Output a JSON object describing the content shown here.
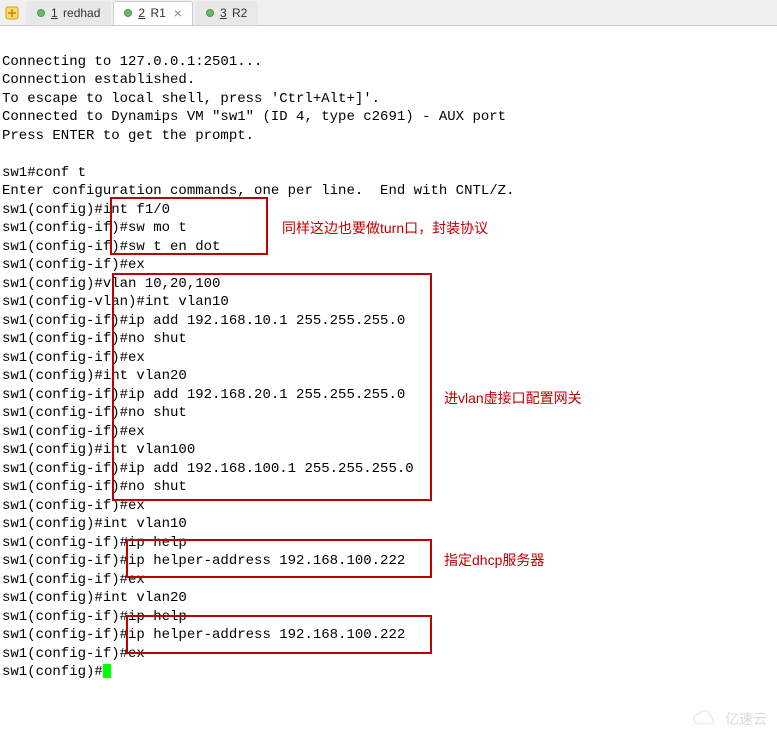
{
  "tabs": [
    {
      "num": "1",
      "label": "redhad",
      "active": false
    },
    {
      "num": "2",
      "label": "R1",
      "active": true
    },
    {
      "num": "3",
      "label": "R2",
      "active": false
    }
  ],
  "terminal_lines": [
    "",
    "Connecting to 127.0.0.1:2501...",
    "Connection established.",
    "To escape to local shell, press 'Ctrl+Alt+]'.",
    "Connected to Dynamips VM \"sw1\" (ID 4, type c2691) - AUX port",
    "Press ENTER to get the prompt.",
    "",
    "sw1#conf t",
    "Enter configuration commands, one per line.  End with CNTL/Z.",
    "sw1(config)#int f1/0",
    "sw1(config-if)#sw mo t",
    "sw1(config-if)#sw t en dot",
    "sw1(config-if)#ex",
    "sw1(config)#vlan 10,20,100",
    "sw1(config-vlan)#int vlan10",
    "sw1(config-if)#ip add 192.168.10.1 255.255.255.0",
    "sw1(config-if)#no shut",
    "sw1(config-if)#ex",
    "sw1(config)#int vlan20",
    "sw1(config-if)#ip add 192.168.20.1 255.255.255.0",
    "sw1(config-if)#no shut",
    "sw1(config-if)#ex",
    "sw1(config)#int vlan100",
    "sw1(config-if)#ip add 192.168.100.1 255.255.255.0",
    "sw1(config-if)#no shut",
    "sw1(config-if)#ex",
    "sw1(config)#int vlan10",
    "sw1(config-if)#ip help",
    "sw1(config-if)#ip helper-address 192.168.100.222",
    "sw1(config-if)#ex",
    "sw1(config)#int vlan20",
    "sw1(config-if)#ip help",
    "sw1(config-if)#ip helper-address 192.168.100.222",
    "sw1(config-if)#ex",
    "sw1(config)#"
  ],
  "annotations": {
    "trunk_note": "同样这边也要做turn口，封装协议",
    "vlan_note": "进vlan虚接口配置网关",
    "dhcp_note": "指定dhcp服务器"
  },
  "watermark": "亿速云"
}
